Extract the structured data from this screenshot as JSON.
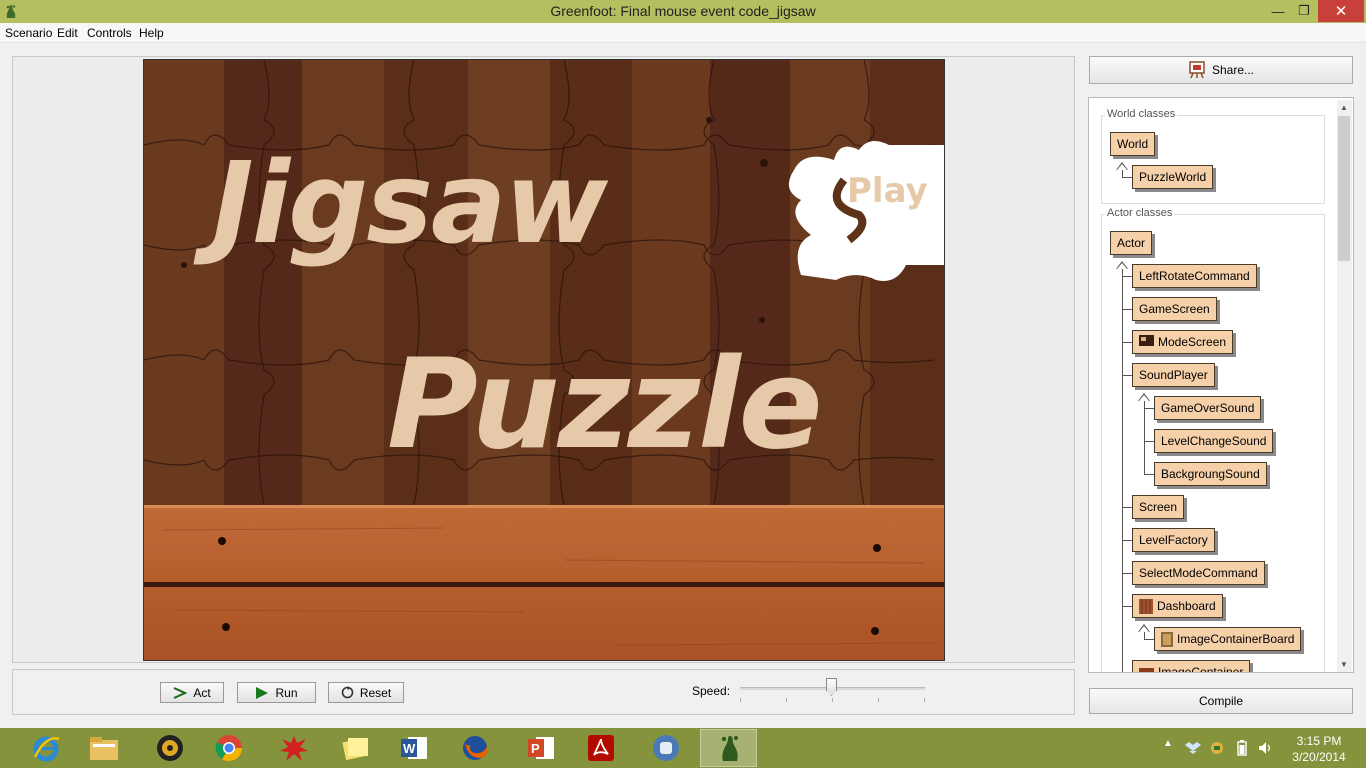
{
  "window": {
    "title": "Greenfoot: Final mouse event code_jigsaw",
    "minimize_glyph": "—",
    "maximize_glyph": "❐",
    "close_glyph": "✕"
  },
  "menu": {
    "items": [
      "Scenario",
      "Edit",
      "Controls",
      "Help"
    ]
  },
  "world": {
    "title_word_1": "Jigsaw",
    "title_word_2": "Puzzle",
    "play_label": "Play"
  },
  "controls": {
    "act_label": "Act",
    "run_label": "Run",
    "reset_label": "Reset",
    "speed_label": "Speed:",
    "speed_value": 0.5
  },
  "sidebar": {
    "share_label": "Share...",
    "world_classes_label": "World classes",
    "actor_classes_label": "Actor classes",
    "world_classes": [
      "World",
      "PuzzleWorld"
    ],
    "actor_classes": [
      "Actor",
      "LeftRotateCommand",
      "GameScreen",
      "ModeScreen",
      "SoundPlayer",
      "GameOverSound",
      "LevelChangeSound",
      "BackgroungSound",
      "Screen",
      "LevelFactory",
      "SelectModeCommand",
      "Dashboard",
      "ImageContainerBoard",
      "ImageContainer"
    ],
    "compile_label": "Compile"
  },
  "taskbar": {
    "apps": [
      "internet-explorer",
      "file-explorer",
      "media-player",
      "chrome",
      "paint-splash",
      "sticky-notes",
      "word",
      "firefox",
      "powerpoint",
      "acrobat",
      "bluej",
      "greenfoot"
    ],
    "clock_time": "3:15 PM",
    "clock_date": "3/20/2014"
  },
  "colors": {
    "titlebar": "#b4bf5f",
    "taskbar": "#85933c",
    "class_box": "#f5d0a9",
    "close_button": "#c7413a",
    "puzzle_text": "#e6c9a8"
  }
}
